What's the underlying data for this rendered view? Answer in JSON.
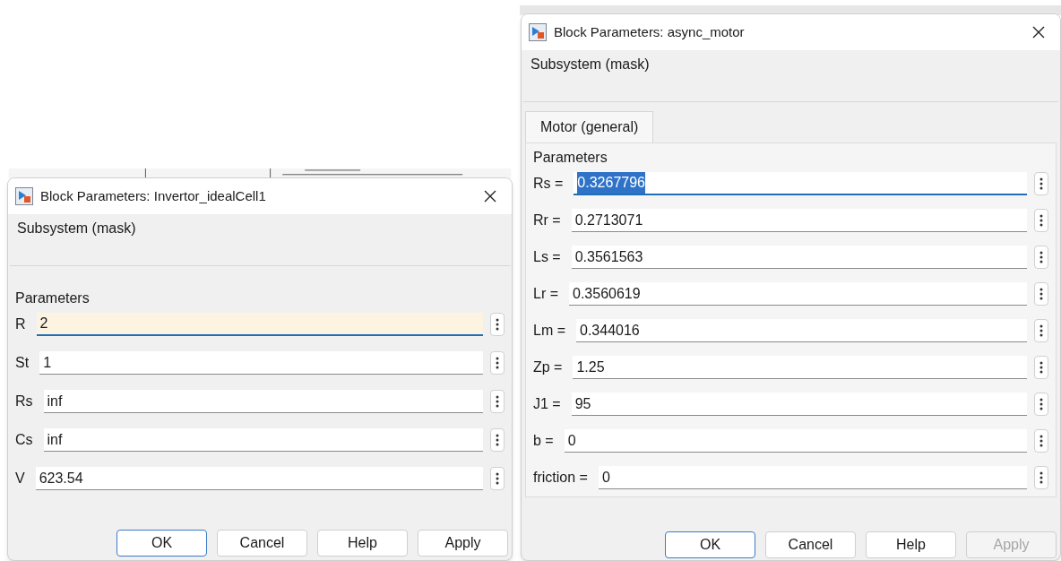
{
  "dialogs": [
    {
      "title": "Block Parameters: Invertor_idealCell1",
      "section": "Subsystem (mask)",
      "group": "Parameters",
      "parameters": [
        {
          "label": "R",
          "value": "2",
          "focused": true,
          "highlighted": false
        },
        {
          "label": "St",
          "value": "1",
          "focused": false,
          "highlighted": false
        },
        {
          "label": "Rs",
          "value": "inf",
          "focused": false,
          "highlighted": false
        },
        {
          "label": "Cs",
          "value": "inf",
          "focused": false,
          "highlighted": false
        },
        {
          "label": "V",
          "value": "623.54",
          "focused": false,
          "highlighted": false
        }
      ],
      "buttons": [
        {
          "label": "OK",
          "default": true,
          "disabled": false
        },
        {
          "label": "Cancel",
          "default": false,
          "disabled": false
        },
        {
          "label": "Help",
          "default": false,
          "disabled": false
        },
        {
          "label": "Apply",
          "default": false,
          "disabled": false
        }
      ]
    },
    {
      "title": "Block Parameters: async_motor",
      "section": "Subsystem (mask)",
      "tabs": [
        {
          "label": "Motor (general)",
          "selected": true
        }
      ],
      "group": "Parameters",
      "parameters": [
        {
          "label": "Rs =",
          "value": "0.3267796",
          "focused": true,
          "highlighted": true
        },
        {
          "label": "Rr =",
          "value": "0.2713071",
          "focused": false,
          "highlighted": false
        },
        {
          "label": "Ls =",
          "value": "0.3561563",
          "focused": false,
          "highlighted": false
        },
        {
          "label": "Lr =",
          "value": "0.3560619",
          "focused": false,
          "highlighted": false
        },
        {
          "label": "Lm =",
          "value": "0.344016",
          "focused": false,
          "highlighted": false
        },
        {
          "label": "Zp =",
          "value": "1.25",
          "focused": false,
          "highlighted": false
        },
        {
          "label": "J1 =",
          "value": "95",
          "focused": false,
          "highlighted": false
        },
        {
          "label": "b =",
          "value": "0",
          "focused": false,
          "highlighted": false
        },
        {
          "label": "friction =",
          "value": "0",
          "focused": false,
          "highlighted": false
        }
      ],
      "buttons": [
        {
          "label": "OK",
          "default": true,
          "disabled": false
        },
        {
          "label": "Cancel",
          "default": false,
          "disabled": false
        },
        {
          "label": "Help",
          "default": false,
          "disabled": false
        },
        {
          "label": "Apply",
          "default": false,
          "disabled": true
        }
      ]
    }
  ]
}
